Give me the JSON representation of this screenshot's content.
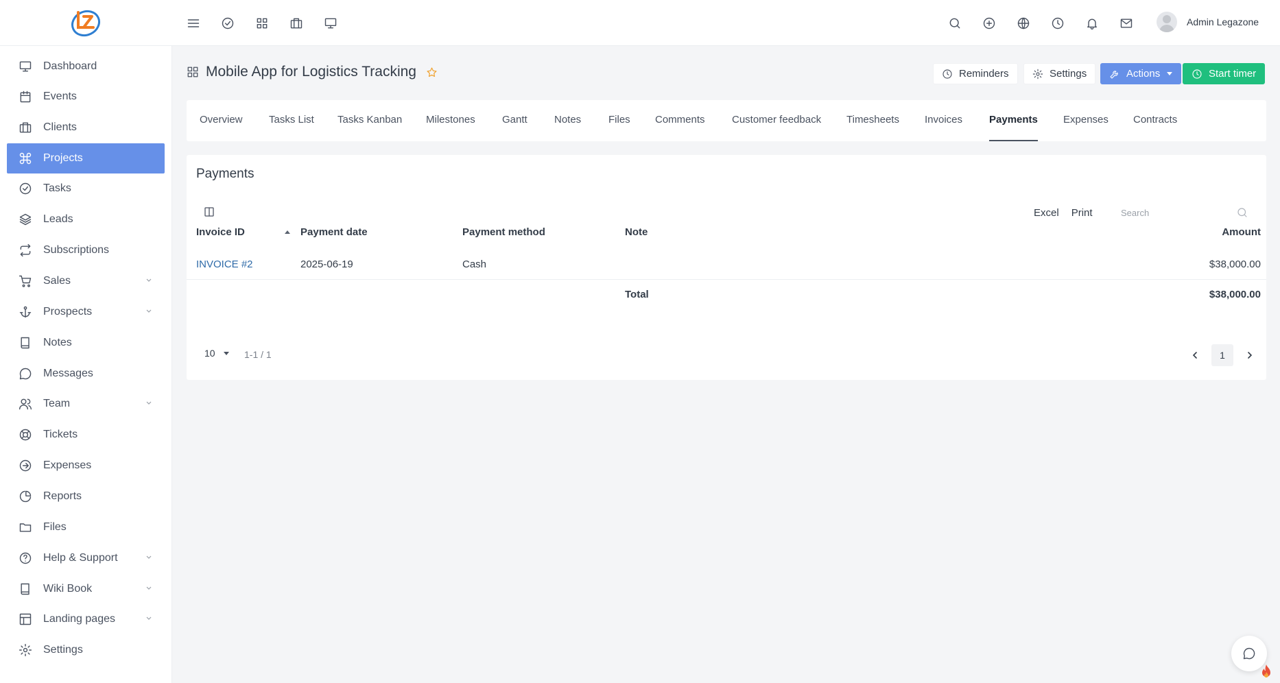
{
  "header": {
    "user_name": "Admin Legazone"
  },
  "sidebar": {
    "items": [
      {
        "label": "Dashboard",
        "icon": "monitor-icon"
      },
      {
        "label": "Events",
        "icon": "calendar-icon"
      },
      {
        "label": "Clients",
        "icon": "briefcase-icon"
      },
      {
        "label": "Projects",
        "icon": "command-icon",
        "active": true
      },
      {
        "label": "Tasks",
        "icon": "check-circle-icon"
      },
      {
        "label": "Leads",
        "icon": "layers-icon"
      },
      {
        "label": "Subscriptions",
        "icon": "repeat-icon"
      },
      {
        "label": "Sales",
        "icon": "cart-icon",
        "expandable": true
      },
      {
        "label": "Prospects",
        "icon": "anchor-icon",
        "expandable": true
      },
      {
        "label": "Notes",
        "icon": "book-icon"
      },
      {
        "label": "Messages",
        "icon": "message-icon"
      },
      {
        "label": "Team",
        "icon": "users-icon",
        "expandable": true
      },
      {
        "label": "Tickets",
        "icon": "life-buoy-icon"
      },
      {
        "label": "Expenses",
        "icon": "arrow-circle-icon"
      },
      {
        "label": "Reports",
        "icon": "pie-chart-icon"
      },
      {
        "label": "Files",
        "icon": "folder-icon"
      },
      {
        "label": "Help & Support",
        "icon": "help-circle-icon",
        "expandable": true
      },
      {
        "label": "Wiki Book",
        "icon": "book-open-icon",
        "expandable": true
      },
      {
        "label": "Landing pages",
        "icon": "layout-icon",
        "expandable": true
      },
      {
        "label": "Settings",
        "icon": "settings-icon"
      }
    ]
  },
  "project": {
    "title": "Mobile App for Logistics Tracking",
    "buttons": {
      "reminders": "Reminders",
      "settings": "Settings",
      "actions": "Actions",
      "start_timer": "Start timer"
    }
  },
  "tabs": [
    "Overview",
    "Tasks List",
    "Tasks Kanban",
    "Milestones",
    "Gantt",
    "Notes",
    "Files",
    "Comments",
    "Customer feedback",
    "Timesheets",
    "Invoices",
    "Payments",
    "Expenses",
    "Contracts"
  ],
  "active_tab": "Payments",
  "payments": {
    "title": "Payments",
    "tools": {
      "excel": "Excel",
      "print": "Print"
    },
    "search_placeholder": "Search",
    "columns": {
      "invoice_id": "Invoice ID",
      "payment_date": "Payment date",
      "payment_method": "Payment method",
      "note": "Note",
      "amount": "Amount"
    },
    "rows": [
      {
        "invoice_id": "INVOICE #2",
        "payment_date": "2025-06-19",
        "payment_method": "Cash",
        "note": "",
        "amount": "$38,000.00"
      }
    ],
    "total_label": "Total",
    "total_amount": "$38,000.00",
    "pager": {
      "page_size": "10",
      "info": "1-1 / 1",
      "current_page": "1"
    }
  },
  "colors": {
    "accent": "#6690e8",
    "success": "#1fbf7e",
    "link": "#2e6aa8",
    "star": "#f0a63a"
  }
}
